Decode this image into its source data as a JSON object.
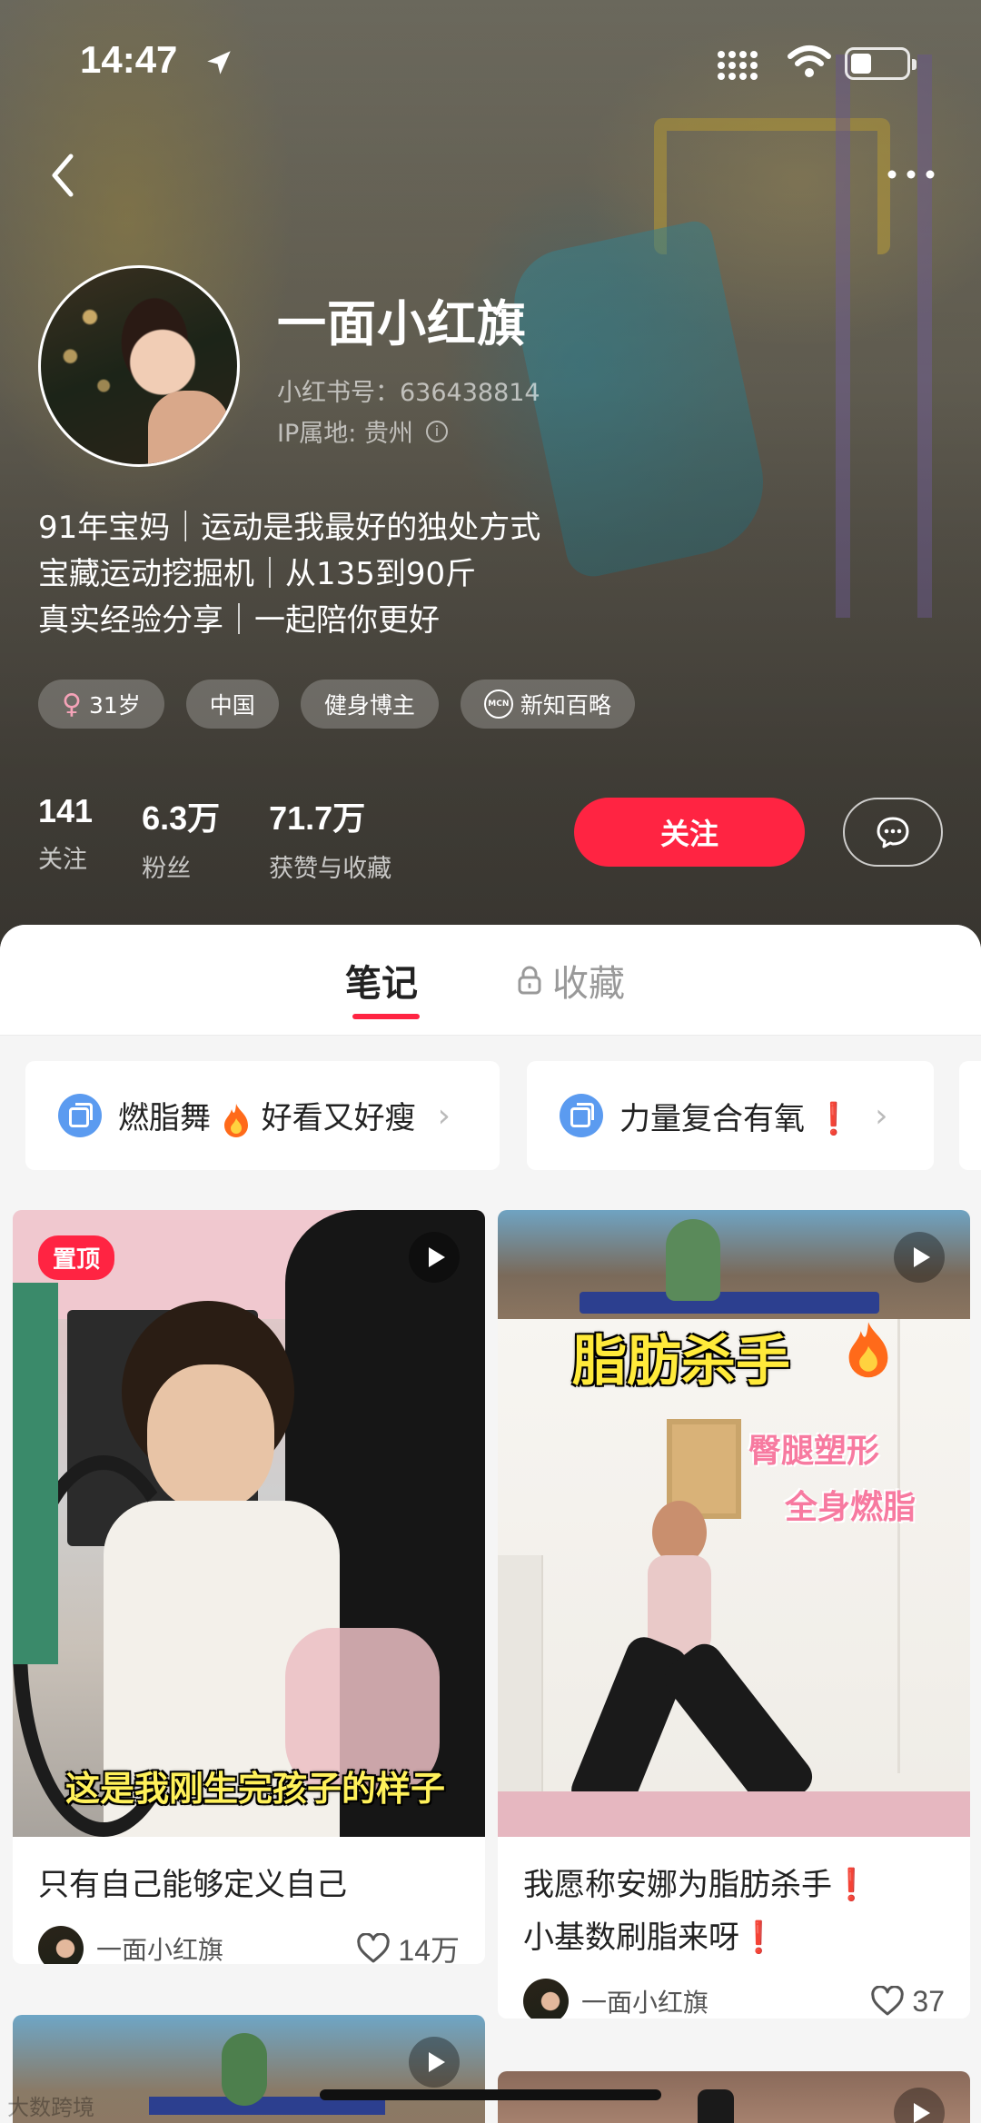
{
  "status_bar": {
    "time": "14:47"
  },
  "profile": {
    "nickname": "一面小红旗",
    "red_id": "小红书号：636438814",
    "ip_location": "IP属地: 贵州",
    "bio_lines": [
      "91年宝妈｜运动是我最好的独处方式",
      "宝藏运动挖掘机｜从135到90斤",
      "真实经验分享｜一起陪你更好"
    ],
    "tags": [
      "31岁",
      "中国",
      "健身博主",
      "新知百略"
    ],
    "stats": [
      {
        "value": "141",
        "label": "关注"
      },
      {
        "value": "6.3万",
        "label": "粉丝"
      },
      {
        "value": "71.7万",
        "label": "获赞与收藏"
      }
    ],
    "follow_label": "关注"
  },
  "tabs": {
    "notes": "笔记",
    "collections": "收藏"
  },
  "collections": [
    {
      "prefix": "燃脂舞",
      "suffix": "好看又好瘦"
    },
    {
      "prefix": "力量复合有氧",
      "suffix": "❗"
    }
  ],
  "cards": [
    {
      "pinned_label": "置顶",
      "caption": "这是我刚生完孩子的样子",
      "title": "只有自己能够定义自己",
      "author": "一面小红旗",
      "likes": "14万"
    },
    {
      "caption_main": "脂肪杀手",
      "caption_sub1": "臀腿塑形",
      "caption_sub2": "全身燃脂",
      "title_line1": "我愿称安娜为脂肪杀手❗",
      "title_line2": "小基数刷脂来呀❗",
      "author": "一面小红旗",
      "likes": "37"
    }
  ],
  "watermark": "大数跨境",
  "colors": {
    "accent": "#ff2442",
    "bg": "#f5f5f5"
  }
}
